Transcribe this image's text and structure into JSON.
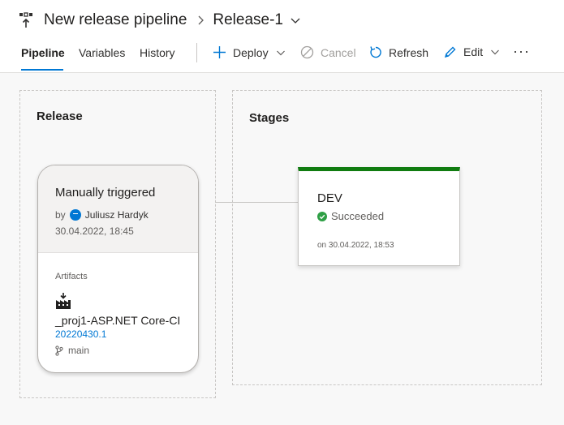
{
  "header": {
    "pipeline_title": "New release pipeline",
    "breadcrumb_separator": ">",
    "release_name": "Release-1",
    "tabs": [
      {
        "label": "Pipeline",
        "active": true
      },
      {
        "label": "Variables",
        "active": false
      },
      {
        "label": "History",
        "active": false
      }
    ],
    "commands": {
      "deploy": "Deploy",
      "cancel": "Cancel",
      "refresh": "Refresh",
      "edit": "Edit",
      "more": "···"
    }
  },
  "release_panel": {
    "title": "Release",
    "trigger": {
      "title": "Manually triggered",
      "by_prefix": "by",
      "user": "Juliusz Hardyk",
      "date": "30.04.2022, 18:45"
    },
    "artifacts": {
      "label": "Artifacts",
      "name": "_proj1-ASP.NET Core-CI",
      "build": "20220430.1",
      "branch": "main"
    }
  },
  "stages_panel": {
    "title": "Stages",
    "stage": {
      "name": "DEV",
      "status": "Succeeded",
      "date": "on 30.04.2022, 18:53"
    }
  },
  "colors": {
    "accent": "#0078d4",
    "success": "#107c10",
    "status_green": "#2e9f45"
  },
  "icons": {
    "pipeline": "release-pipeline-icon",
    "deploy": "plus-icon",
    "cancel": "cancel-icon",
    "refresh": "refresh-icon",
    "edit": "pencil-icon",
    "artifact": "build-artifact-icon",
    "branch": "git-branch-icon",
    "status": "check-circle-icon"
  }
}
